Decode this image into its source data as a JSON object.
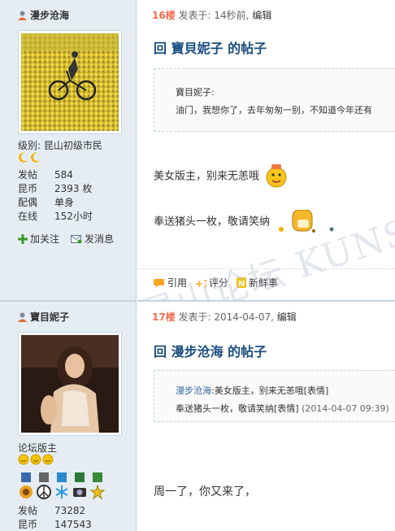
{
  "post1": {
    "author": "漫步沧海",
    "level": "级别: 昆山初级市民",
    "stats": [
      {
        "label": "发帖",
        "value": "584"
      },
      {
        "label": "昆币",
        "value": "2393 枚"
      },
      {
        "label": "配偶",
        "value": "单身"
      },
      {
        "label": "在线",
        "value": "152小时"
      }
    ],
    "follow_label": "加关注",
    "message_label": "发消息",
    "floor": "16楼",
    "posted": "发表于: 14秒前",
    "edit": "编辑",
    "title": "回 寶貝妮子 的帖子",
    "quote_user": "寶目妮子:",
    "quote_text": "油门，我想你了，去年匆匆一别，不知道今年还有",
    "message1": "美女版主，别来无恙哦",
    "message2": "奉送猪头一枚，敬请笑纳",
    "footer": {
      "quote": "引用",
      "rate": "评分",
      "fresh": "新鲜事"
    }
  },
  "post2": {
    "author": "寶目妮子",
    "role": "论坛版主",
    "stats": [
      {
        "label": "发帖",
        "value": "73282"
      },
      {
        "label": "昆币",
        "value": "147543"
      }
    ],
    "floor": "17楼",
    "posted": "发表于: 2014-04-07",
    "edit": "编辑",
    "title": "回 漫步沧海 的帖子",
    "quote_user": "漫步沧海",
    "quote_line1": ":美女版主，别来无恙哦[表情]",
    "quote_line2": "奉送猪头一枚，敬请笑纳[表情]",
    "quote_time": "(2014-04-07 09:39)",
    "message": "周一了，你又来了，"
  },
  "watermark": "昆山论坛 KUNSHAN BBS",
  "colors": {
    "floor": "#f26c4f",
    "title": "#1a4d80",
    "link": "#336699",
    "sidebar_bg": "#e5edf2"
  }
}
